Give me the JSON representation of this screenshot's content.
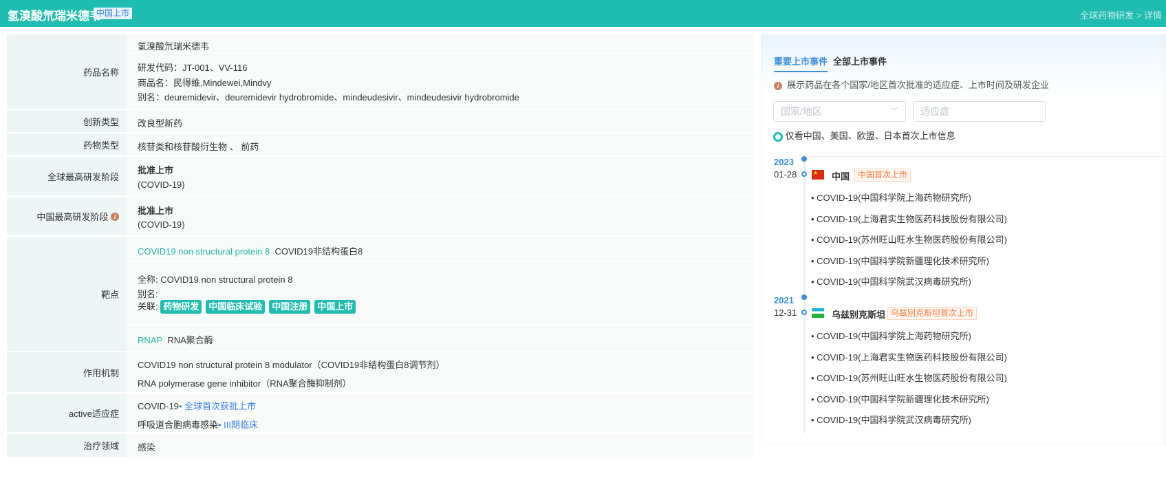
{
  "header": {
    "title": "氢溴酸氘瑞米德韦",
    "badge": "中国上市",
    "breadcrumb": "全球药物研发 > 详情"
  },
  "drug_name": {
    "label": "药品名称",
    "name": "氢溴酸氘瑞米德韦",
    "code": "研发代码：JT-001、VV-116",
    "trade": "商品名：民得维,Mindewei,Mindvy",
    "alias": "别名：deuremidevir、deuremidevir hydrobromide、mindeudesivir、mindeudesivir hydrobromide"
  },
  "innovation": {
    "label": "创新类型",
    "value": "改良型新药"
  },
  "drug_type": {
    "label": "药物类型",
    "value": "核苷类和核苷酸衍生物 、 前药"
  },
  "global_phase": {
    "label": "全球最高研发阶段",
    "value": "批准上市",
    "sub": "(COVID-19)"
  },
  "china_phase": {
    "label": "中国最高研发阶段",
    "value": "批准上市",
    "sub": "(COVID-19)"
  },
  "target": {
    "label": "靶点",
    "t1_en": "COVID19 non structural protein 8",
    "t1_cn": "COVID19非结构蛋白8",
    "full_label": "全称:",
    "full": "COVID19 non structural protein 8",
    "alias_label": "别名:",
    "rel_label": "关联:",
    "tags": [
      "药物研发",
      "中国临床试验",
      "中国注册",
      "中国上市"
    ],
    "t2_en": "RNAP",
    "t2_cn": "RNA聚合酶"
  },
  "mechanism": {
    "label": "作用机制",
    "items": [
      "COVID19 non structural protein 8 modulator（COVID19非结构蛋白8调节剂）",
      "RNA polymerase gene inhibitor（RNA聚合酶抑制剂）"
    ]
  },
  "indication": {
    "label": "active适应症",
    "items": [
      {
        "name": "COVID-19",
        "status": "• 全球首次获批上市"
      },
      {
        "name": "呼吸道合胞病毒感染",
        "status": "• III期临床"
      }
    ]
  },
  "area": {
    "label": "治疗领域",
    "value": "感染"
  },
  "panel": {
    "tabs": [
      "重要上市事件",
      "全部上市事件"
    ],
    "info": "展示药品在各个国家/地区首次批准的适应症、上市时间及研发企业",
    "country_placeholder": "国家/地区",
    "indication_placeholder": "适应症",
    "radio": "仅看中国、美国、欧盟、日本首次上市信息",
    "events": [
      {
        "year": "2023",
        "date": "01-28",
        "country": "中国",
        "tag": "中国首次上市",
        "flag": "cn",
        "items": [
          "COVID-19(中国科学院上海药物研究所)",
          "COVID-19(上海君实生物医药科技股份有限公司)",
          "COVID-19(苏州旺山旺水生物医药股份有限公司)",
          "COVID-19(中国科学院新疆理化技术研究所)",
          "COVID-19(中国科学院武汉病毒研究所)"
        ]
      },
      {
        "year": "2021",
        "date": "12-31",
        "country": "乌兹别克斯坦",
        "tag": "乌兹别克斯坦首次上市",
        "flag": "uz",
        "items": [
          "COVID-19(中国科学院上海药物研究所)",
          "COVID-19(上海君实生物医药科技股份有限公司)",
          "COVID-19(苏州旺山旺水生物医药股份有限公司)",
          "COVID-19(中国科学院新疆理化技术研究所)",
          "COVID-19(中国科学院武汉病毒研究所)"
        ]
      }
    ]
  }
}
